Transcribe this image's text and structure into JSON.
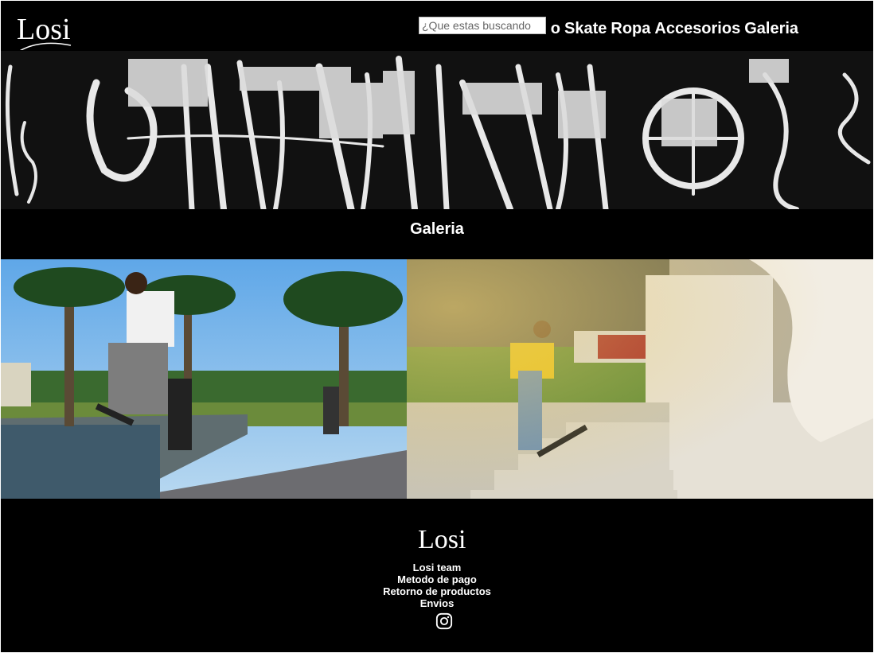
{
  "header": {
    "logo_text": "Losi",
    "search": {
      "placeholder": "¿Que estas buscando",
      "value": ""
    },
    "nav": [
      {
        "label": "Inicio",
        "visible_label": "nicio"
      },
      {
        "label": "Skate"
      },
      {
        "label": "Ropa"
      },
      {
        "label": "Accesorios"
      },
      {
        "label": "Galeria"
      }
    ]
  },
  "gallery": {
    "title": "Galeria",
    "photos": [
      {
        "subject": "skater-kickflip-park-palms"
      },
      {
        "subject": "skater-stairs-monument"
      }
    ]
  },
  "footer": {
    "logo_text": "Losi",
    "links": [
      "Losi team",
      "Metodo de pago",
      "Retorno de productos",
      "Envios"
    ],
    "social": "instagram-icon"
  },
  "colors": {
    "background": "#000000",
    "text": "#ffffff"
  }
}
